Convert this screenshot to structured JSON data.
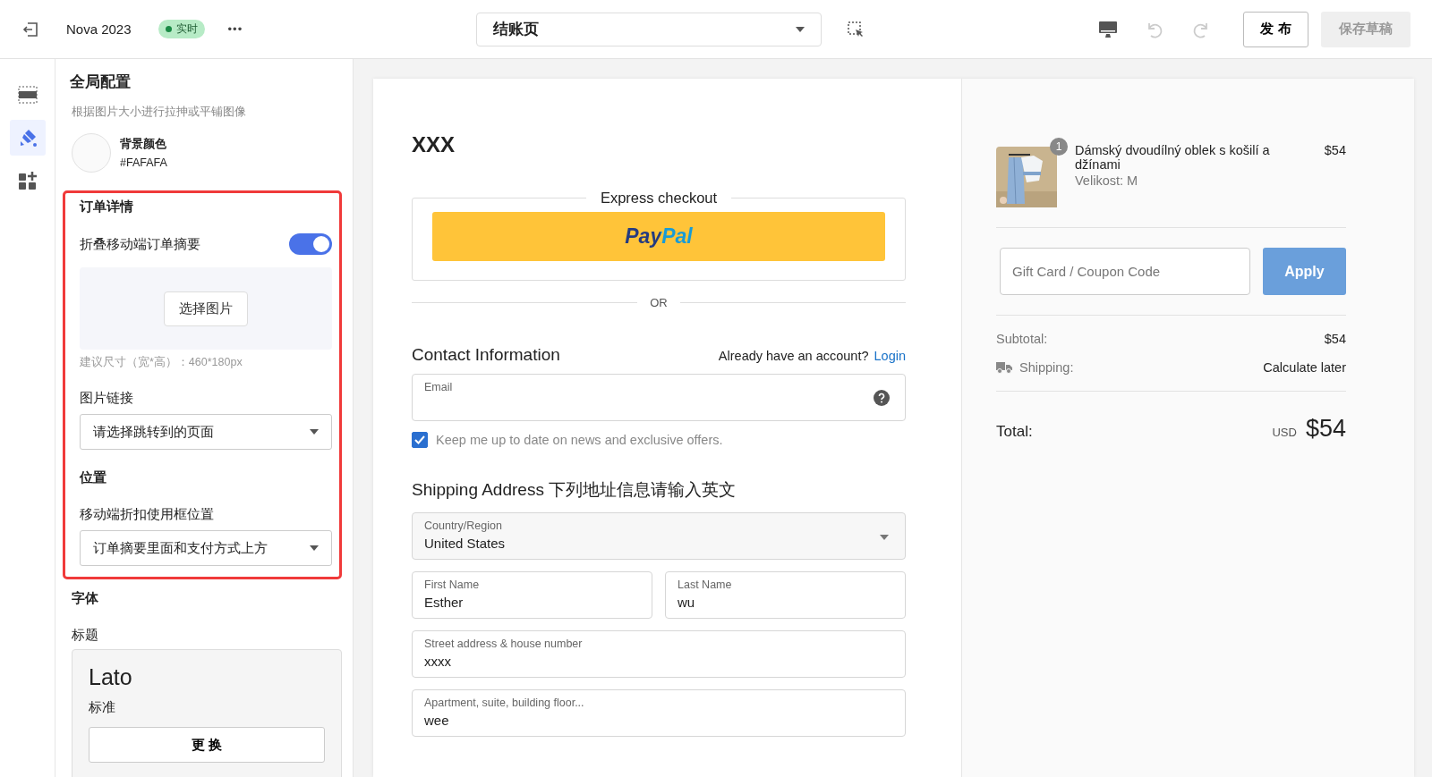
{
  "topbar": {
    "project": "Nova 2023",
    "status": "实时",
    "more": "•••",
    "page_select": "结账页",
    "publish": "发 布",
    "save_draft": "保存草稿",
    "undo_disabled": true,
    "redo_disabled": true,
    "save_disabled": true
  },
  "rail": [
    {
      "kind": "sections",
      "selected": false
    },
    {
      "kind": "theme",
      "selected": true
    },
    {
      "kind": "apps",
      "selected": false
    }
  ],
  "panel": {
    "title": "全局配置",
    "subtitle": "根据图片大小进行拉抻或平铺图像",
    "bg_color": {
      "label": "背景颜色",
      "value": "#FAFAFA",
      "color": "#fafafa"
    },
    "order_details": {
      "highlighted": true,
      "title": "订单详情",
      "toggle_label": "折叠移动端订单摘要",
      "toggle_on": true,
      "choose_image": "选择图片",
      "size_hint": "建议尺寸（宽*高）：460*180px",
      "link_label": "图片链接",
      "link_select": "请选择跳转到的页面",
      "position_title": "位置",
      "position_label": "移动端折扣使用框位置",
      "position_select": "订单摘要里面和支付方式上方"
    },
    "font": {
      "title": "字体",
      "heading_label": "标题",
      "font_name": "Lato",
      "font_weight": "标准",
      "change": "更 换"
    }
  },
  "checkout": {
    "store": "XXX",
    "express_title": "Express checkout",
    "paypal": "PayPal",
    "or": "OR",
    "contact_title": "Contact Information",
    "account_prompt": "Already have an account?",
    "login": "Login",
    "email_label": "Email",
    "newsletter": "Keep me up to date on news and exclusive offers.",
    "newsletter_checked": true,
    "shipping_title": "Shipping Address 下列地址信息请输入英文",
    "fields": [
      {
        "kind": "select",
        "label": "Country/Region",
        "value": "United States"
      },
      {
        "kind": "pair",
        "items": [
          {
            "label": "First Name",
            "value": "Esther"
          },
          {
            "label": "Last Name",
            "value": "wu"
          }
        ]
      },
      {
        "kind": "text",
        "label": "Street address & house number",
        "value": "xxxx"
      },
      {
        "kind": "text",
        "label": "Apartment, suite, building floor...",
        "value": "wee"
      }
    ]
  },
  "summary": {
    "item": {
      "name": "Dámský dvoudílný oblek s košilí a džínami",
      "variant": "Velikost: M",
      "price": "$54",
      "quantity": "1",
      "kind": "picture"
    },
    "coupon_placeholder": "Gift Card / Coupon Code",
    "apply": "Apply",
    "subtotal_label": "Subtotal:",
    "subtotal": "$54",
    "shipping_label": "Shipping:",
    "shipping": "Calculate later",
    "total_label": "Total:",
    "currency": "USD",
    "total": "$54"
  }
}
